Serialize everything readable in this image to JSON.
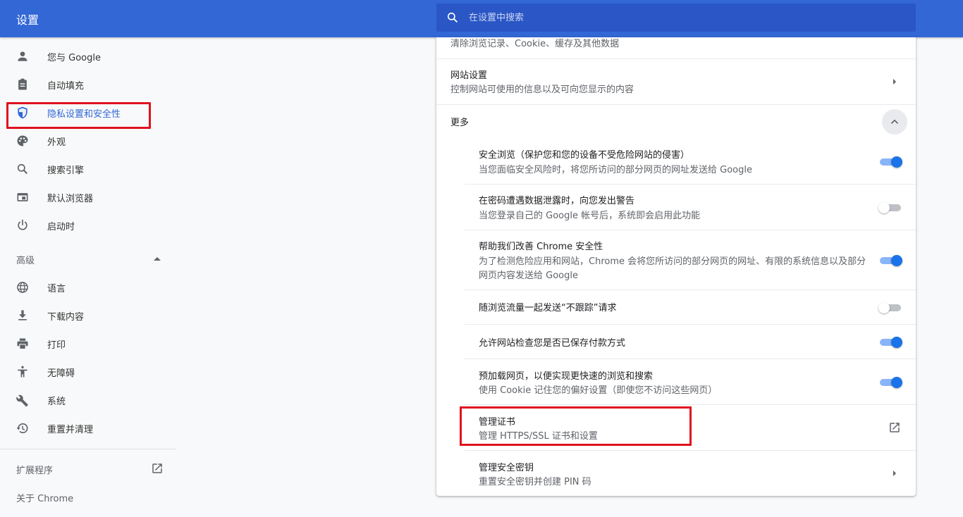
{
  "header": {
    "title": "设置",
    "search_placeholder": "在设置中搜索"
  },
  "sidebar": {
    "items": [
      {
        "label": "您与 Google",
        "icon": "person-icon"
      },
      {
        "label": "自动填充",
        "icon": "clipboard-icon"
      },
      {
        "label": "隐私设置和安全性",
        "icon": "shield-icon",
        "active": true
      },
      {
        "label": "外观",
        "icon": "palette-icon"
      },
      {
        "label": "搜索引擎",
        "icon": "search-icon"
      },
      {
        "label": "默认浏览器",
        "icon": "browser-icon"
      },
      {
        "label": "启动时",
        "icon": "power-icon"
      }
    ],
    "advanced_label": "高级",
    "advanced_items": [
      {
        "label": "语言",
        "icon": "globe-icon"
      },
      {
        "label": "下载内容",
        "icon": "download-icon"
      },
      {
        "label": "打印",
        "icon": "printer-icon"
      },
      {
        "label": "无障碍",
        "icon": "accessibility-icon"
      },
      {
        "label": "系统",
        "icon": "wrench-icon"
      },
      {
        "label": "重置并清理",
        "icon": "history-icon"
      }
    ],
    "extensions_label": "扩展程序",
    "about_label": "关于 Chrome"
  },
  "main": {
    "clear_browsing_sub": "清除浏览记录、Cookie、缓存及其他数据",
    "site_settings": {
      "title": "网站设置",
      "sub": "控制网站可使用的信息以及可向您显示的内容"
    },
    "more_label": "更多",
    "settings": [
      {
        "title": "安全浏览（保护您和您的设备不受危险网站的侵害）",
        "sub": "当您面临安全风险时，将您所访问的部分网页的网址发送给 Google",
        "enabled": true
      },
      {
        "title": "在密码遭遇数据泄露时，向您发出警告",
        "sub": "当您登录自己的 Google 帐号后，系统即会启用此功能",
        "enabled": false
      },
      {
        "title": "帮助我们改善 Chrome 安全性",
        "sub": "为了检测危险应用和网站，Chrome 会将您所访问的部分网页的网址、有限的系统信息以及部分",
        "sub2": "网页内容发送给 Google",
        "enabled": true
      },
      {
        "title": "随浏览流量一起发送“不跟踪”请求",
        "enabled": false
      },
      {
        "title": "允许网站检查您是否已保存付款方式",
        "enabled": true
      },
      {
        "title": "预加载网页，以便实现更快速的浏览和搜索",
        "sub": "使用 Cookie 记住您的偏好设置（即使您不访问这些网页）",
        "enabled": true
      }
    ],
    "manage_certs": {
      "title": "管理证书",
      "sub": "管理 HTTPS/SSL 证书和设置"
    },
    "security_keys": {
      "title": "管理安全密钥",
      "sub": "重置安全密钥并创建 PIN 码"
    }
  }
}
